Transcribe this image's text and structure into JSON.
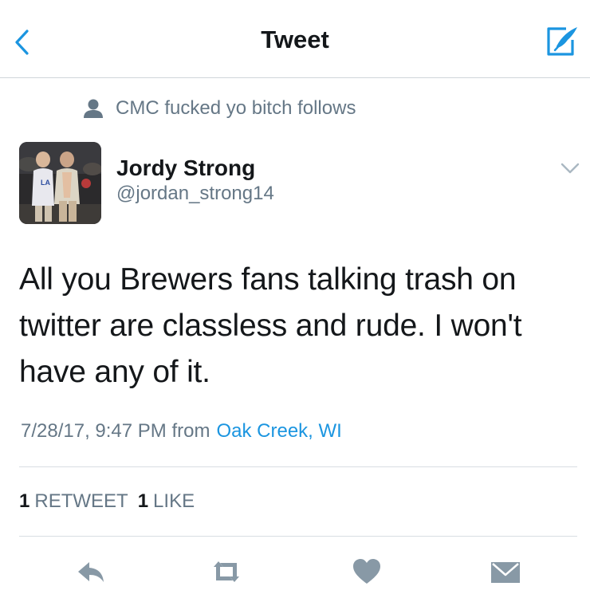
{
  "nav": {
    "title": "Tweet",
    "back_icon": "chevron-left-icon",
    "compose_icon": "compose-tweet-icon",
    "accent_color": "#1b95e0"
  },
  "social_context": {
    "icon": "person-icon",
    "text": "CMC fucked yo bitch follows"
  },
  "tweet": {
    "author_name": "Jordy Strong",
    "author_handle": "@jordan_strong14",
    "text": "All you Brewers fans talking trash on twitter are classless and rude. I won't have any of it.",
    "timestamp": "7/28/17, 9:47 PM from",
    "location": "Oak Creek, WI",
    "retweet_count": "1",
    "retweet_label": "RETWEET",
    "like_count": "1",
    "like_label": "LIKE"
  },
  "actions": [
    {
      "name": "reply",
      "icon": "reply-icon"
    },
    {
      "name": "retweet",
      "icon": "retweet-icon"
    },
    {
      "name": "like",
      "icon": "heart-icon"
    },
    {
      "name": "direct-message",
      "icon": "envelope-icon"
    }
  ],
  "colors": {
    "text_primary": "#14171a",
    "text_secondary": "#657786",
    "link": "#1b95e0",
    "icon_gray": "#8899a6"
  }
}
